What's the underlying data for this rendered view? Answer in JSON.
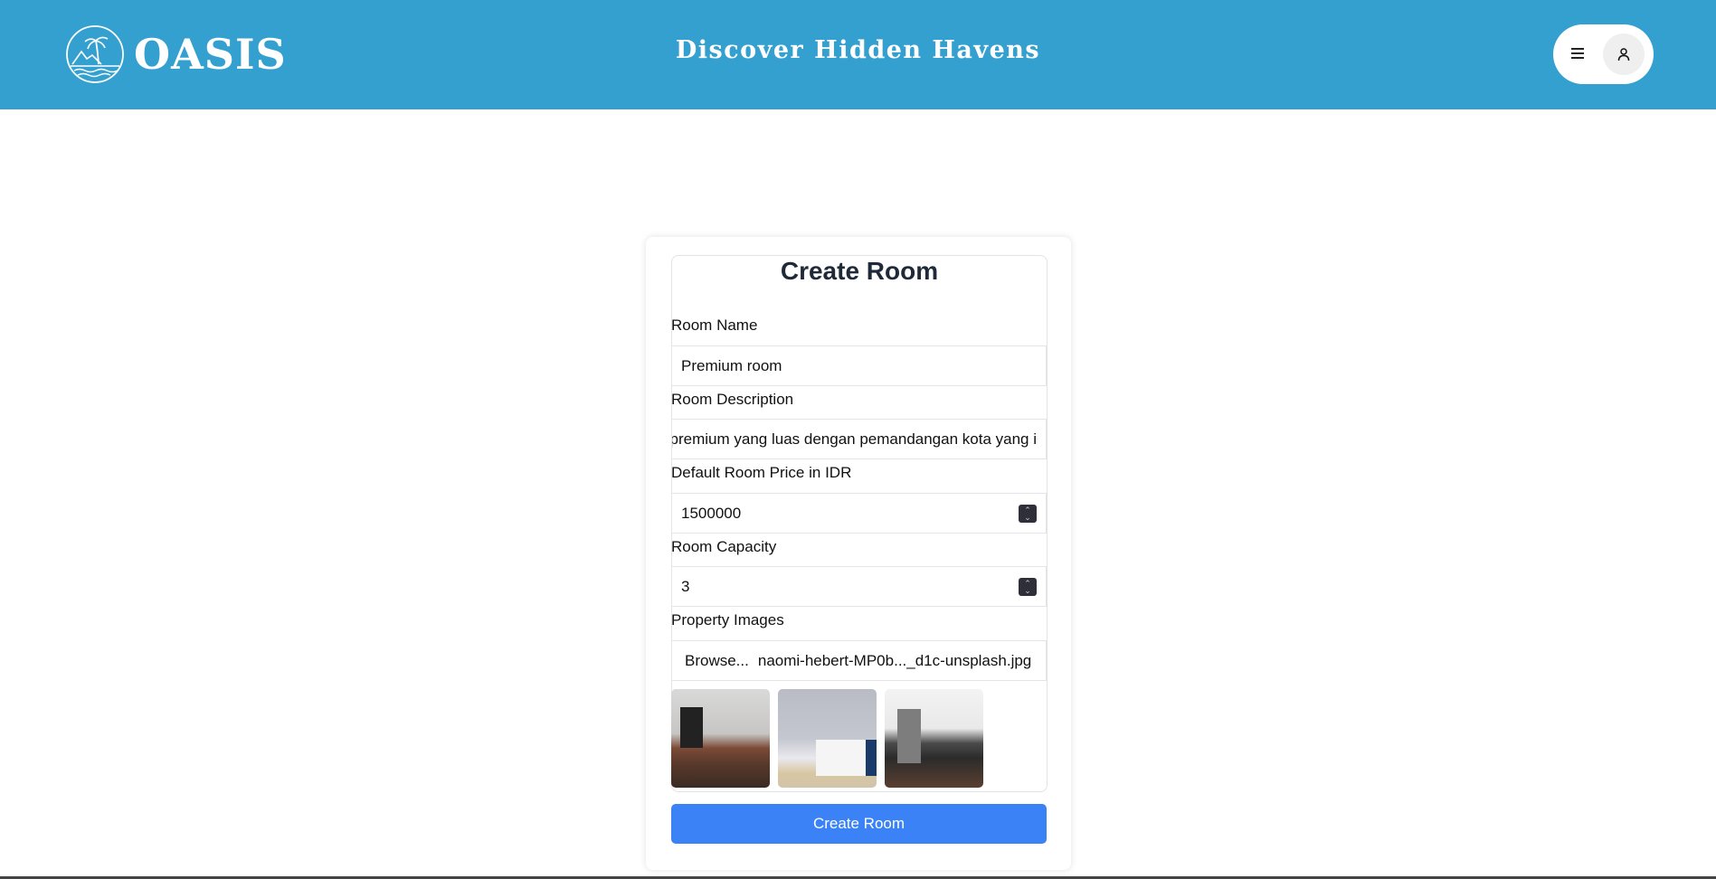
{
  "header": {
    "logo_text": "OASIS",
    "tagline": "Discover Hidden Havens"
  },
  "form": {
    "title": "Create Room",
    "room_name_label": "Room Name",
    "room_name_value": "Premium room",
    "room_description_label": "Room Description",
    "room_description_value": "premium yang luas dengan pemandangan kota yang i",
    "price_label": "Default Room Price in IDR",
    "price_value": "1500000",
    "capacity_label": "Room Capacity",
    "capacity_value": "3",
    "images_label": "Property Images",
    "browse_label": "Browse...",
    "file_name": "naomi-hebert-MP0b..._d1c-unsplash.jpg",
    "submit_label": "Create Room"
  },
  "icons": {
    "menu": "hamburger-icon",
    "user": "user-icon",
    "logo": "palm-island-icon"
  },
  "colors": {
    "header": "#34a0d0",
    "accent": "#3b82f6"
  }
}
